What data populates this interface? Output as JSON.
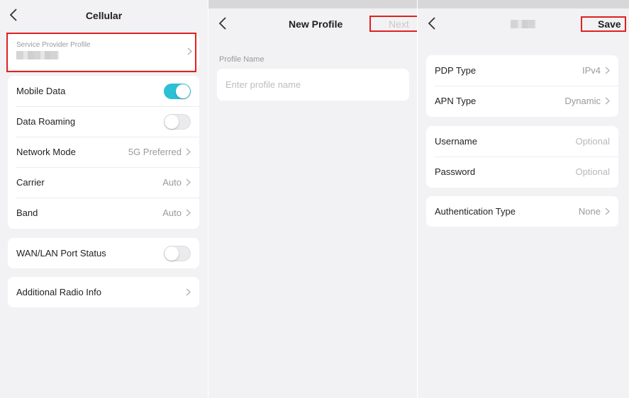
{
  "cellular": {
    "title": "Cellular",
    "provider_profile": {
      "label": "Service Provider Profile"
    },
    "rows": [
      {
        "label": "Mobile Data",
        "toggle": "on"
      },
      {
        "label": "Data Roaming",
        "toggle": "off"
      },
      {
        "label": "Network Mode",
        "value": "5G Preferred"
      },
      {
        "label": "Carrier",
        "value": "Auto"
      },
      {
        "label": "Band",
        "value": "Auto"
      }
    ],
    "wan_lan": {
      "label": "WAN/LAN Port Status",
      "toggle": "off"
    },
    "additional": {
      "label": "Additional Radio Info"
    }
  },
  "new_profile": {
    "title": "New Profile",
    "next_label": "Next",
    "field_label": "Profile Name",
    "placeholder": "Enter profile name"
  },
  "profile_edit": {
    "save_label": "Save",
    "pdp": {
      "label": "PDP Type",
      "value": "IPv4"
    },
    "apn": {
      "label": "APN Type",
      "value": "Dynamic"
    },
    "username": {
      "label": "Username",
      "placeholder": "Optional"
    },
    "password": {
      "label": "Password",
      "placeholder": "Optional"
    },
    "auth": {
      "label": "Authentication Type",
      "value": "None"
    }
  },
  "colors": {
    "accent": "#2bc0d4",
    "highlight": "#e02020",
    "disabled_text": "#c8c8c8"
  },
  "icons": {
    "back": "chevron-left-icon",
    "forward": "chevron-right-icon"
  }
}
